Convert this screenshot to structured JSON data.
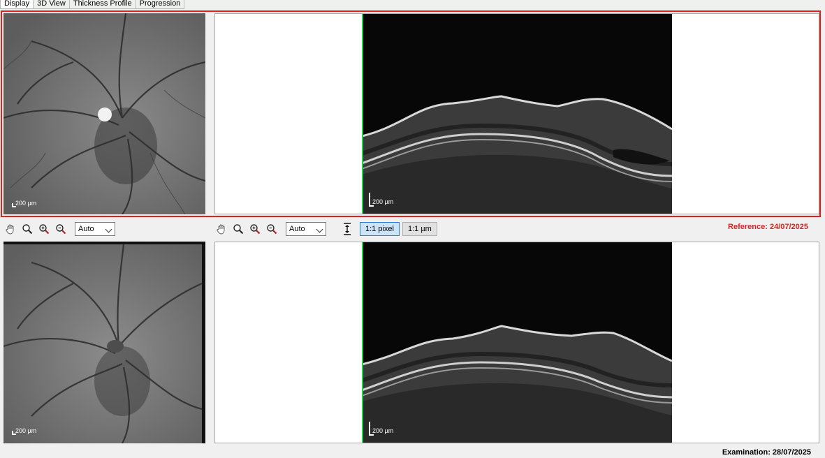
{
  "tabs": [
    {
      "label": "Display"
    },
    {
      "label": "3D View"
    },
    {
      "label": "Thickness Profile"
    },
    {
      "label": "Progression"
    }
  ],
  "top": {
    "fundus_scale": "200 µm",
    "bscan_scale": "200 µm"
  },
  "bottom": {
    "fundus_scale": "200 µm",
    "bscan_scale": "200 µm"
  },
  "toolbar": {
    "left_zoom_select": "Auto",
    "right_zoom_select": "Auto",
    "pixel_button": "1:1 pixel",
    "micron_button": "1:1 µm"
  },
  "reference_label": "Reference: 24/07/2025",
  "examination_label": "Examination: 28/07/2025",
  "colors": {
    "accent": "#e01f1f",
    "scan_line": "#22d34a",
    "selected_button": "#cce4f7"
  },
  "icons": [
    "hand-icon",
    "magnifier-icon",
    "zoom-in-icon",
    "zoom-out-icon",
    "fit-height-icon"
  ]
}
